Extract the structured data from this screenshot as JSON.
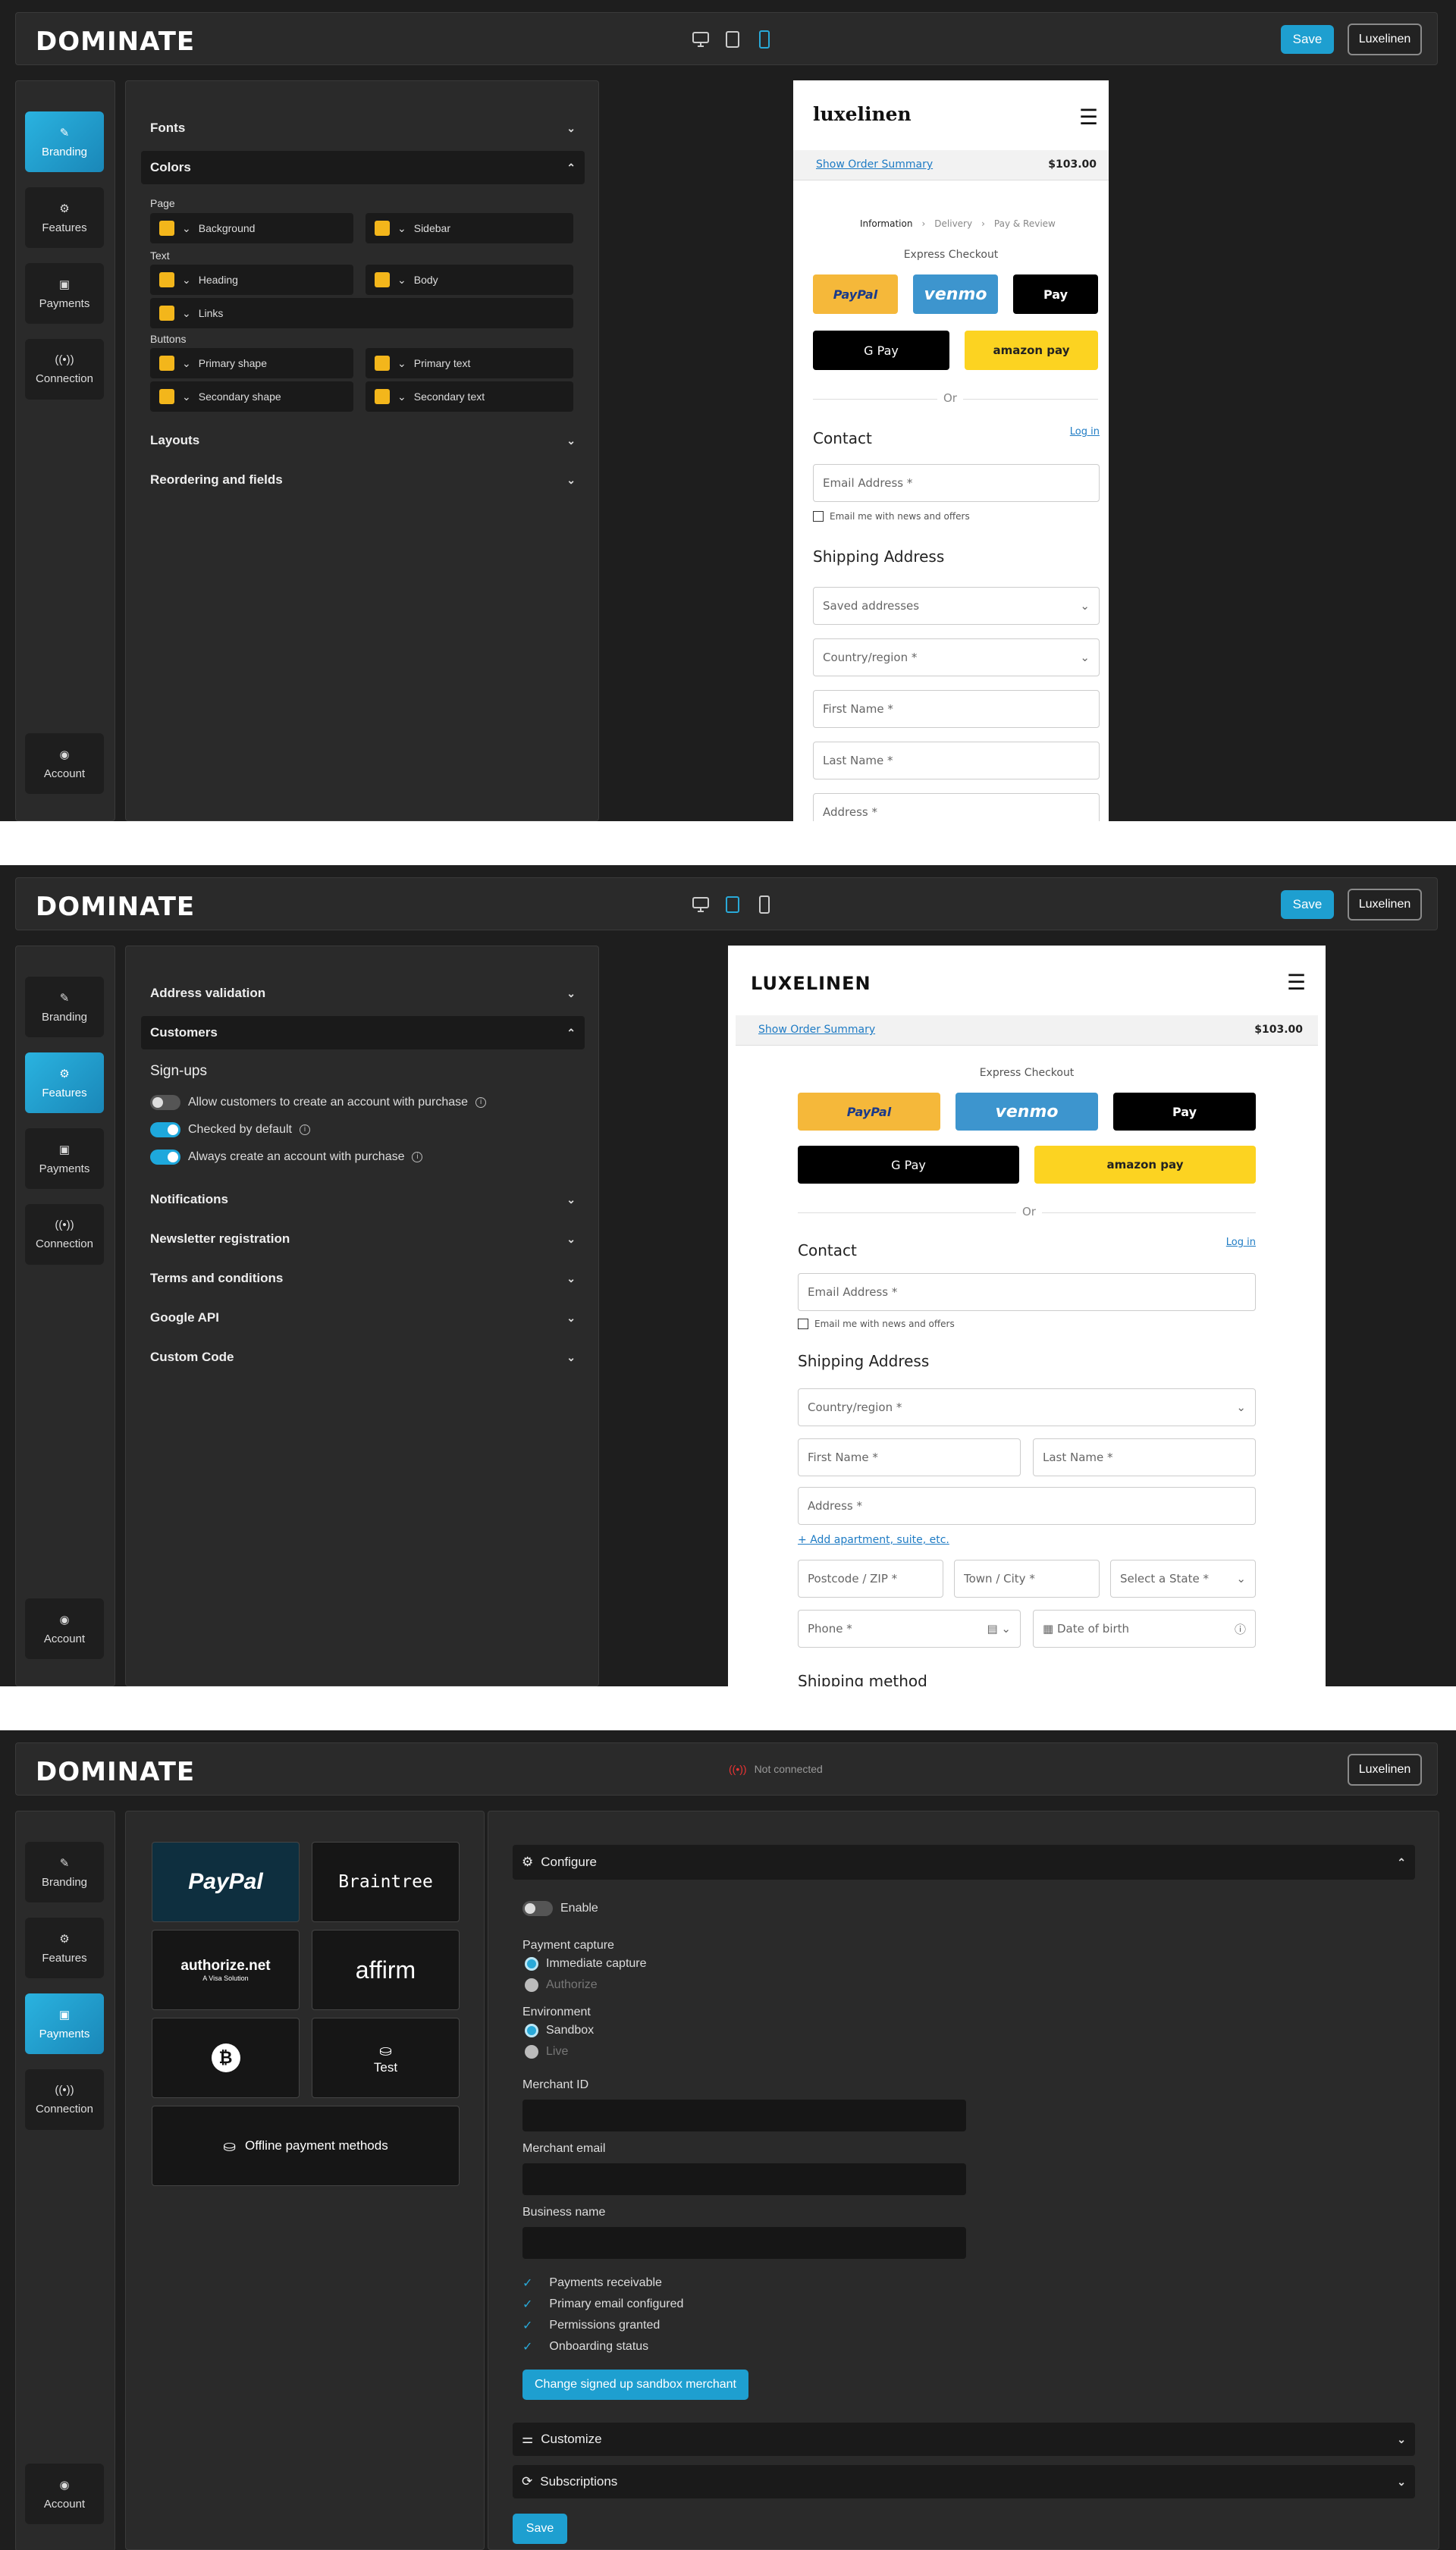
{
  "brand": "DOMINATE",
  "top": {
    "save": "Save",
    "store": "Luxelinen",
    "status": "Not connected"
  },
  "nav": {
    "branding": "Branding",
    "features": "Features",
    "payments": "Payments",
    "connection": "Connection",
    "account": "Account"
  },
  "s1": {
    "fonts": "Fonts",
    "colors": "Colors",
    "page": "Page",
    "background": "Background",
    "sidebar": "Sidebar",
    "text": "Text",
    "heading": "Heading",
    "body": "Body",
    "links": "Links",
    "buttons": "Buttons",
    "primary_shape": "Primary shape",
    "primary_text": "Primary text",
    "secondary_shape": "Secondary shape",
    "secondary_text": "Secondary text",
    "layouts": "Layouts",
    "reordering": "Reordering and fields"
  },
  "preview": {
    "store1": "luxelinen",
    "store2": "LUXELINEN",
    "order_summary": "Show Order Summary",
    "total": "$103.00",
    "crumb1": "Information",
    "crumb2": "Delivery",
    "crumb3": "Pay & Review",
    "express": "Express Checkout",
    "paypal": "PayPal",
    "venmo": "venmo",
    "applepay": "Pay",
    "gpay": "G Pay",
    "amazon": "amazon pay",
    "or": "Or",
    "contact": "Contact",
    "login": "Log in",
    "email": "Email Address *",
    "news": "Email me with news and offers",
    "shipping": "Shipping Address",
    "saved": "Saved addresses",
    "country": "Country/region *",
    "first": "First Name *",
    "last": "Last Name *",
    "address": "Address *",
    "apartment": "Add apartment, suite, etc.",
    "postcode": "Postcode / ZIP *",
    "town": "Town / City *",
    "state": "Select a State *",
    "phone": "Phone *",
    "dob": "Date of birth",
    "shipping_method": "Shipping method"
  },
  "s2": {
    "address_validation": "Address validation",
    "customers": "Customers",
    "signups": "Sign-ups",
    "opt1": "Allow customers to create an account with purchase",
    "opt2": "Checked by default",
    "opt3": "Always create an account with purchase",
    "notifications": "Notifications",
    "newsletter": "Newsletter registration",
    "terms": "Terms and conditions",
    "google": "Google API",
    "custom": "Custom Code"
  },
  "s3": {
    "paypal": "PayPal",
    "braintree": "Braintree",
    "authorize": "authorize.net",
    "authorize_sub": "A Visa Solution",
    "affirm": "affirm",
    "test": "Test",
    "offline": "Offline payment methods",
    "configure": "Configure",
    "enable": "Enable",
    "capture": "Payment capture",
    "immediate": "Immediate capture",
    "authorize_opt": "Authorize",
    "environment": "Environment",
    "sandbox": "Sandbox",
    "live": "Live",
    "merchant_id": "Merchant ID",
    "merchant_email": "Merchant email",
    "business": "Business name",
    "c1": "Payments receivable",
    "c2": "Primary email configured",
    "c3": "Permissions granted",
    "c4": "Onboarding status",
    "change": "Change signed up sandbox merchant",
    "customize": "Customize",
    "subscriptions": "Subscriptions",
    "save": "Save"
  }
}
